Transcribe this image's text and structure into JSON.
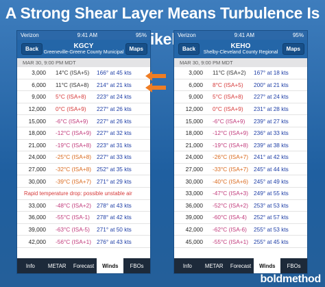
{
  "banner": {
    "title": "A Strong Shear Layer Means Turbulence Is Likely"
  },
  "logo": {
    "text": "boldmethod"
  },
  "phones": {
    "left": {
      "status": {
        "carrier": "Verizon",
        "time": "9:41 AM",
        "battery": "95%"
      },
      "nav": {
        "back": "Back",
        "id": "KGCY",
        "name": "Greeneville-Greene County Municipal",
        "maps": "Maps"
      },
      "date": "MAR 30, 9:00 PM MDT",
      "rows": [
        {
          "alt": "3,000",
          "temp": "14°C (ISA+5)",
          "wind": "166° at 45 kts"
        },
        {
          "alt": "6,000",
          "temp": "11°C (ISA+8)",
          "wind": "214° at 21 kts"
        },
        {
          "alt": "9,000",
          "temp": "5°C (ISA+8)",
          "wind": "223° at 24 kts"
        },
        {
          "alt": "12,000",
          "temp": "0°C (ISA+9)",
          "wind": "227° at 26 kts"
        },
        {
          "alt": "15,000",
          "temp": "-6°C (ISA+9)",
          "wind": "227° at 26 kts"
        },
        {
          "alt": "18,000",
          "temp": "-12°C (ISA+9)",
          "wind": "227° at 32 kts"
        },
        {
          "alt": "21,000",
          "temp": "-19°C (ISA+8)",
          "wind": "223° at 31 kts"
        },
        {
          "alt": "24,000",
          "temp": "-25°C (ISA+8)",
          "wind": "227° at 33 kts"
        },
        {
          "alt": "27,000",
          "temp": "-32°C (ISA+8)",
          "wind": "252° at 35 kts"
        },
        {
          "alt": "30,000",
          "temp": "-39°C (ISA+7)",
          "wind": "271° at 29 kts"
        }
      ],
      "warning": "Rapid temperature drop: possible unstable air",
      "rows2": [
        {
          "alt": "33,000",
          "temp": "-48°C (ISA+2)",
          "wind": "278° at 43 kts"
        },
        {
          "alt": "36,000",
          "temp": "-55°C (ISA-1)",
          "wind": "278° at 42 kts"
        },
        {
          "alt": "39,000",
          "temp": "-63°C (ISA-5)",
          "wind": "271° at 50 kts"
        },
        {
          "alt": "42,000",
          "temp": "-56°C (ISA+1)",
          "wind": "276° at 43 kts"
        }
      ],
      "tabs": [
        "Info",
        "METAR",
        "Forecast",
        "Winds",
        "FBOs"
      ]
    },
    "right": {
      "status": {
        "carrier": "Verizon",
        "time": "9:41 AM",
        "battery": "95%"
      },
      "nav": {
        "back": "Back",
        "id": "KEHO",
        "name": "Shelby-Cleveland County Regional",
        "maps": "Maps"
      },
      "date": "MAR 30, 9:00 PM MDT",
      "rows": [
        {
          "alt": "3,000",
          "temp": "11°C (ISA+2)",
          "wind": "167° at 18 kts"
        },
        {
          "alt": "6,000",
          "temp": "8°C (ISA+5)",
          "wind": "200° at 21 kts"
        },
        {
          "alt": "9,000",
          "temp": "5°C (ISA+8)",
          "wind": "227° at 24 kts"
        },
        {
          "alt": "12,000",
          "temp": "0°C (ISA+9)",
          "wind": "231° at 28 kts"
        },
        {
          "alt": "15,000",
          "temp": "-6°C (ISA+9)",
          "wind": "239° at 27 kts"
        },
        {
          "alt": "18,000",
          "temp": "-12°C (ISA+9)",
          "wind": "236° at 33 kts"
        },
        {
          "alt": "21,000",
          "temp": "-19°C (ISA+8)",
          "wind": "239° at 38 kts"
        },
        {
          "alt": "24,000",
          "temp": "-26°C (ISA+7)",
          "wind": "241° at 42 kts"
        },
        {
          "alt": "27,000",
          "temp": "-33°C (ISA+7)",
          "wind": "245° at 44 kts"
        },
        {
          "alt": "30,000",
          "temp": "-40°C (ISA+6)",
          "wind": "245° at 49 kts"
        },
        {
          "alt": "33,000",
          "temp": "-47°C (ISA+3)",
          "wind": "249° at 55 kts"
        },
        {
          "alt": "36,000",
          "temp": "-52°C (ISA+2)",
          "wind": "253° at 53 kts"
        },
        {
          "alt": "39,000",
          "temp": "-60°C (ISA-4)",
          "wind": "252° at 57 kts"
        },
        {
          "alt": "42,000",
          "temp": "-62°C (ISA-6)",
          "wind": "255° at 53 kts"
        },
        {
          "alt": "45,000",
          "temp": "-55°C (ISA+1)",
          "wind": "255° at 45 kts"
        }
      ],
      "tabs": [
        "Info",
        "METAR",
        "Forecast",
        "Winds",
        "FBOs"
      ]
    }
  },
  "colors": {
    "warm": "#2c8a2c",
    "cool": "#c0397a",
    "arrow": "#ef7d24"
  }
}
